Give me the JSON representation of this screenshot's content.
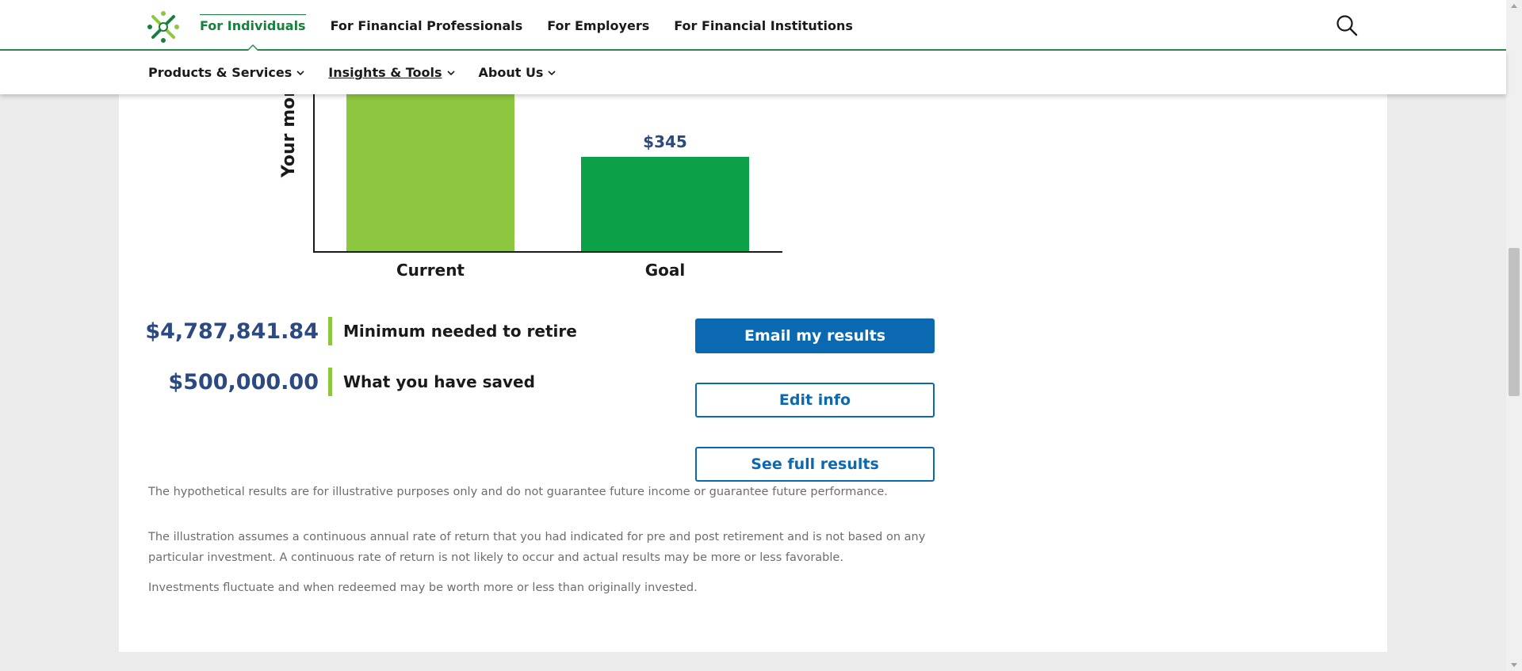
{
  "colors": {
    "brand_green": "#17803d",
    "bar_current": "#8dc63f",
    "bar_goal": "#0ca048",
    "amount_blue": "#2c4a7f",
    "button_blue": "#0b69b1"
  },
  "topnav": {
    "items": [
      {
        "label": "For Individuals",
        "active": true
      },
      {
        "label": "For Financial Professionals"
      },
      {
        "label": "For Employers"
      },
      {
        "label": "For Financial Institutions"
      }
    ],
    "search_icon": "search-icon",
    "logo_icon": "brand-logo-icon"
  },
  "subnav": {
    "items": [
      {
        "label": "Products & Services"
      },
      {
        "label": "Insights & Tools"
      },
      {
        "label": "About Us"
      }
    ]
  },
  "chart_data": {
    "type": "bar",
    "ylabel": "Your montl",
    "categories": [
      "Current",
      "Goal"
    ],
    "values": [
      null,
      345
    ],
    "data_labels": [
      "",
      "$345"
    ]
  },
  "stats": [
    {
      "amount": "$4,787,841.84",
      "label": "Minimum needed to retire"
    },
    {
      "amount": "$500,000.00",
      "label": "What you have saved"
    }
  ],
  "buttons": {
    "email": "Email my results",
    "edit": "Edit info",
    "full": "See full results"
  },
  "disclaimers": [
    "The hypothetical results are for illustrative purposes only and do not guarantee future income or guarantee future performance.",
    "The illustration assumes a continuous annual rate of return that you had indicated for pre and post retirement and is not based on any particular investment. A continuous rate of return is not likely to occur and actual results may be more or less favorable.",
    "Investments fluctuate and when redeemed may be worth more or less than originally invested."
  ]
}
